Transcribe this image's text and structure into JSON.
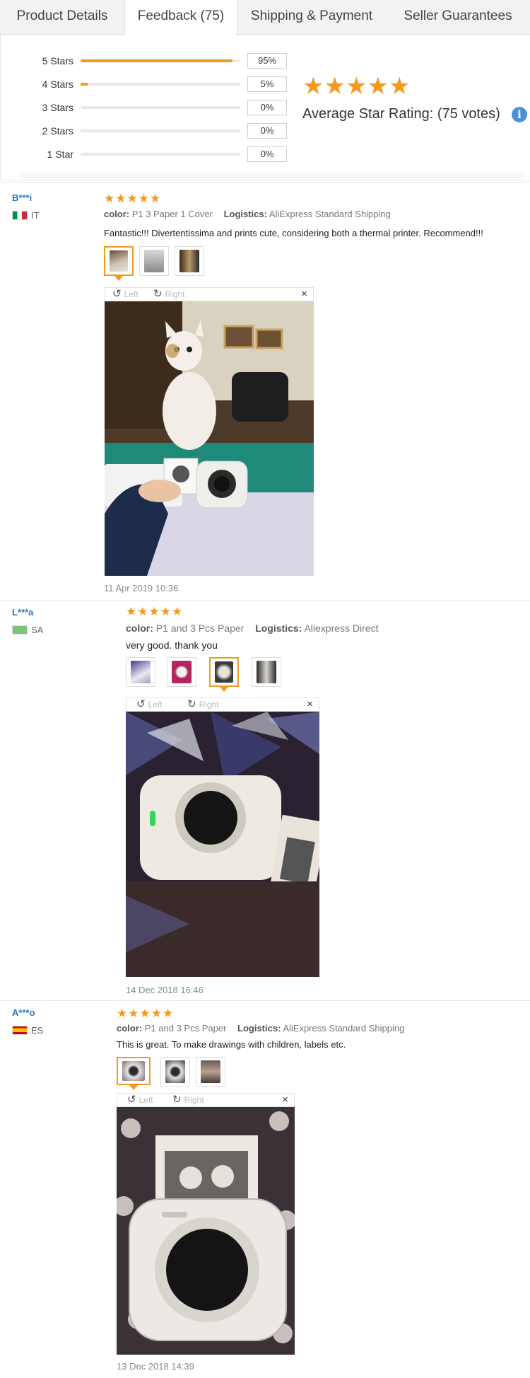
{
  "tabs": [
    {
      "label": "Product Details"
    },
    {
      "label": "Feedback (75)"
    },
    {
      "label": "Shipping & Payment"
    },
    {
      "label": "Seller Guarantees"
    }
  ],
  "rating_summary": {
    "rows": [
      {
        "label": "5 Stars",
        "percent": "95%",
        "fraction": 0.95
      },
      {
        "label": "4 Stars",
        "percent": "5%",
        "fraction": 0.05
      },
      {
        "label": "3 Stars",
        "percent": "0%",
        "fraction": 0
      },
      {
        "label": "2 Stars",
        "percent": "0%",
        "fraction": 0
      },
      {
        "label": "1 Star",
        "percent": "0%",
        "fraction": 0
      }
    ],
    "stars": "★★★★★",
    "average_label": "Average Star Rating:  (75 votes)",
    "info_icon": "info-icon",
    "info_glyph": "i"
  },
  "viewer": {
    "left_label": "Left",
    "right_label": "Right",
    "close_glyph": "×",
    "rotate_left_glyph": "↺",
    "rotate_right_glyph": "↻"
  },
  "reviews": [
    {
      "user": "B***i",
      "country": "IT",
      "stars": "★★★★★",
      "color_label": "color:",
      "color_value": "P1 3 Paper 1 Cover",
      "logistics_label": "Logistics:",
      "logistics_value": "AliExpress Standard Shipping",
      "text": "Fantastic!!! Divertentissima and prints cute, considering both a thermal printer. Recommend!!!",
      "date": "11 Apr 2019 10:36"
    },
    {
      "user": "L***a",
      "country": "SA",
      "stars": "★★★★★",
      "color_label": "color:",
      "color_value": "P1 and 3 Pcs Paper",
      "logistics_label": "Logistics:",
      "logistics_value": "Aliexpress Direct",
      "text": "very good. thank you",
      "date": "14 Dec 2018 16:46"
    },
    {
      "user": "A***o",
      "country": "ES",
      "stars": "★★★★★",
      "color_label": "color:",
      "color_value": "P1 and 3 Pcs Paper",
      "logistics_label": "Logistics:",
      "logistics_value": "AliExpress Standard Shipping",
      "text": "This is great. To make drawings with children, labels etc.",
      "date": "13 Dec 2018 14:39"
    }
  ],
  "colors": {
    "accent": "#f29a1f",
    "link": "#2a7ac2",
    "info": "#4a90d9"
  }
}
